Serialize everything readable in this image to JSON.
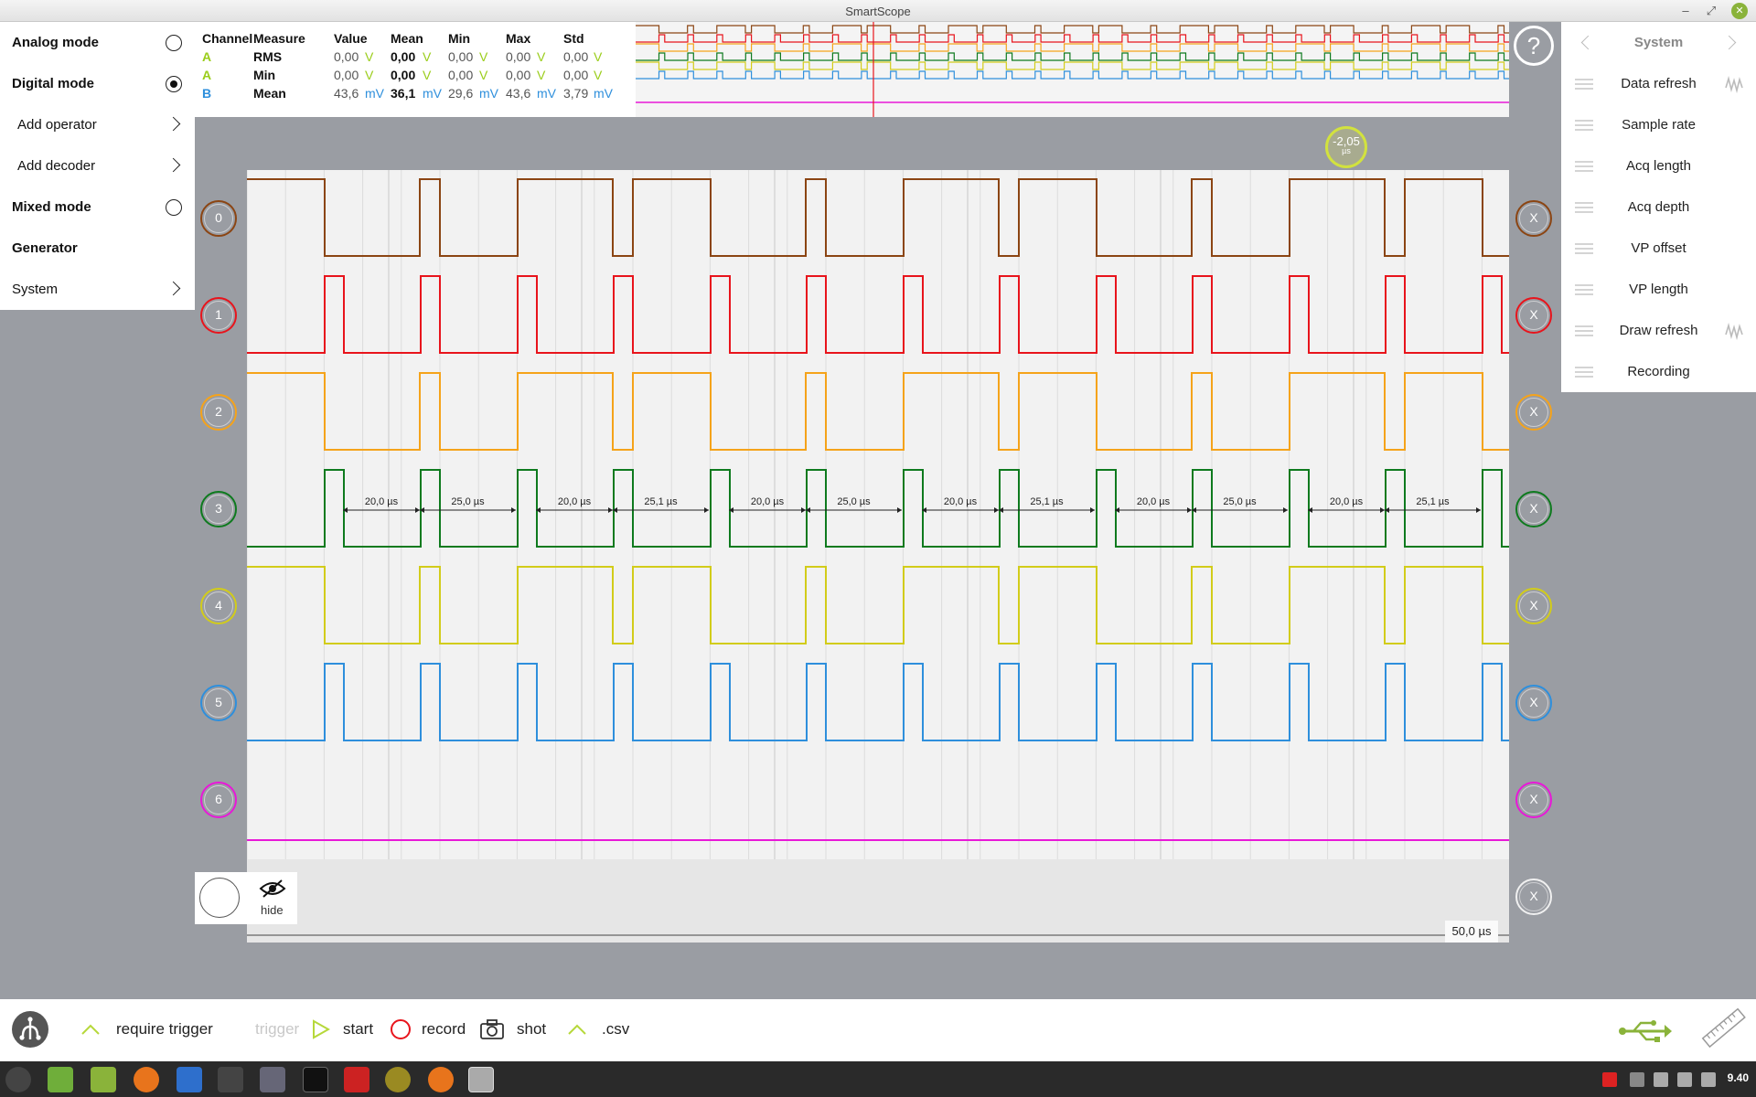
{
  "window": {
    "title": "SmartScope"
  },
  "left_menu": [
    {
      "label": "Analog mode",
      "bold": true,
      "type": "radio",
      "selected": false
    },
    {
      "label": "Digital mode",
      "bold": true,
      "type": "radio",
      "selected": true
    },
    {
      "label": "Add operator",
      "bold": false,
      "type": "submenu"
    },
    {
      "label": "Add decoder",
      "bold": false,
      "type": "submenu"
    },
    {
      "label": "Mixed mode",
      "bold": true,
      "type": "radio",
      "selected": false
    },
    {
      "label": "Generator",
      "bold": true,
      "type": "header"
    },
    {
      "label": "System",
      "bold": false,
      "type": "submenu"
    }
  ],
  "measurements": {
    "headers": [
      "Channel",
      "Measure",
      "Value",
      "Mean",
      "Min",
      "Max",
      "Std"
    ],
    "rows": [
      {
        "channel": "A",
        "measure": "RMS",
        "value": "0,00",
        "value_unit": "V",
        "mean": "0,00",
        "mean_unit": "V",
        "min": "0,00",
        "min_unit": "V",
        "max": "0,00",
        "max_unit": "V",
        "std": "0,00",
        "std_unit": "V"
      },
      {
        "channel": "A",
        "measure": "Min",
        "value": "0,00",
        "value_unit": "V",
        "mean": "0,00",
        "mean_unit": "V",
        "min": "0,00",
        "min_unit": "V",
        "max": "0,00",
        "max_unit": "V",
        "std": "0,00",
        "std_unit": "V"
      },
      {
        "channel": "B",
        "measure": "Mean",
        "value": "43,6",
        "value_unit": "mV",
        "mean": "36,1",
        "mean_unit": "mV",
        "min": "29,6",
        "min_unit": "mV",
        "max": "43,6",
        "max_unit": "mV",
        "std": "3,79",
        "std_unit": "mV"
      }
    ]
  },
  "right_menu": {
    "title": "System",
    "items": [
      {
        "label": "Data refresh",
        "wave": true
      },
      {
        "label": "Sample rate",
        "wave": false
      },
      {
        "label": "Acq length",
        "wave": false
      },
      {
        "label": "Acq depth",
        "wave": false
      },
      {
        "label": "VP offset",
        "wave": false
      },
      {
        "label": "VP length",
        "wave": false
      },
      {
        "label": "Draw refresh",
        "wave": true
      },
      {
        "label": "Recording",
        "wave": false
      }
    ]
  },
  "help": {
    "label": "?"
  },
  "channels": [
    {
      "label": "0",
      "color": "#8b4513"
    },
    {
      "label": "1",
      "color": "#e8141c"
    },
    {
      "label": "2",
      "color": "#f5a31a"
    },
    {
      "label": "3",
      "color": "#0e7a1e"
    },
    {
      "label": "4",
      "color": "#d2cc1a"
    },
    {
      "label": "5",
      "color": "#2e8fdc"
    },
    {
      "label": "6",
      "color": "#e818d8"
    },
    {
      "label": "",
      "color": "#f0f0f0"
    }
  ],
  "channel_close_label": "X",
  "trigger": {
    "value": "-2,05",
    "unit": "µs",
    "color": "#d2e23e"
  },
  "interval_labels": [
    "20,0 µs",
    "25,0 µs",
    "20,0 µs",
    "25,1 µs",
    "20,0 µs",
    "25,0 µs",
    "20,0 µs",
    "25,1 µs",
    "20,0 µs",
    "25,0 µs",
    "20,0 µs",
    "25,1 µs"
  ],
  "timebase": "50,0 µs",
  "hide_label": "hide",
  "toolbar": {
    "require_trigger": "require trigger",
    "trigger": "trigger",
    "start": "start",
    "record": "record",
    "shot": "shot",
    "csv": ".csv"
  },
  "clock": "9.40",
  "colors": {
    "accent": "#9acd1a",
    "blue": "#2e8fdc",
    "background": "#9a9da3",
    "plot": "#f2f2f2"
  }
}
